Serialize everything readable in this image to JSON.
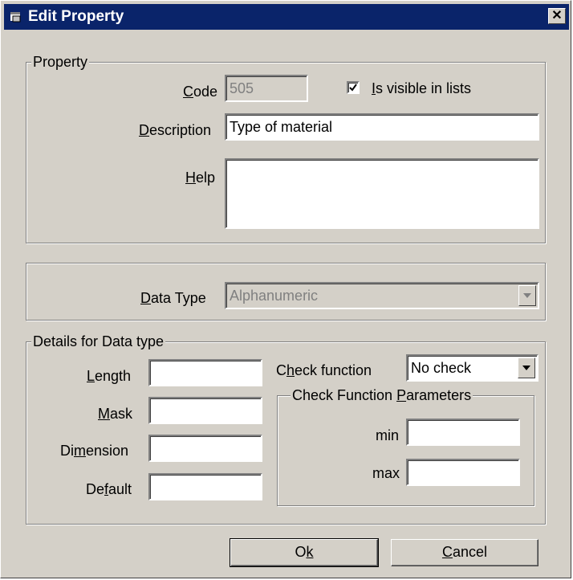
{
  "window": {
    "title": "Edit Property",
    "icon": "property-window-icon",
    "close_label": "✕"
  },
  "property_group": {
    "legend": "Property",
    "code": {
      "label_u": "C",
      "label_rest": "ode",
      "value": "505"
    },
    "visible_in_lists": {
      "label_u": "I",
      "label_rest": "s visible in lists",
      "checked": true
    },
    "description": {
      "label_u": "D",
      "label_rest": "escription",
      "value": "Type of material"
    },
    "help": {
      "label_u": "H",
      "label_rest": "elp",
      "value": ""
    }
  },
  "data_type_group": {
    "label_u": "D",
    "label_rest": "ata Type",
    "value": "Alphanumeric"
  },
  "details_group": {
    "legend": "Details for Data type",
    "length": {
      "label_u": "L",
      "label_rest": "ength",
      "value": ""
    },
    "mask": {
      "label_u": "M",
      "label_rest": "ask",
      "value": ""
    },
    "dimension": {
      "label_pre": "Di",
      "label_u": "m",
      "label_rest": "ension",
      "value": ""
    },
    "default": {
      "label_pre": "De",
      "label_u": "f",
      "label_rest": "ault",
      "value": ""
    },
    "check_function": {
      "label_pre": "C",
      "label_u": "h",
      "label_rest": "eck function",
      "value": "No check"
    },
    "params": {
      "legend_pre": "Check Function ",
      "legend_u": "P",
      "legend_rest": "arameters",
      "min_label": "min",
      "min_value": "",
      "max_label": "max",
      "max_value": ""
    }
  },
  "buttons": {
    "ok": {
      "label_pre": "O",
      "label_u": "k"
    },
    "cancel": {
      "label_u": "C",
      "label_rest": "ancel"
    }
  }
}
